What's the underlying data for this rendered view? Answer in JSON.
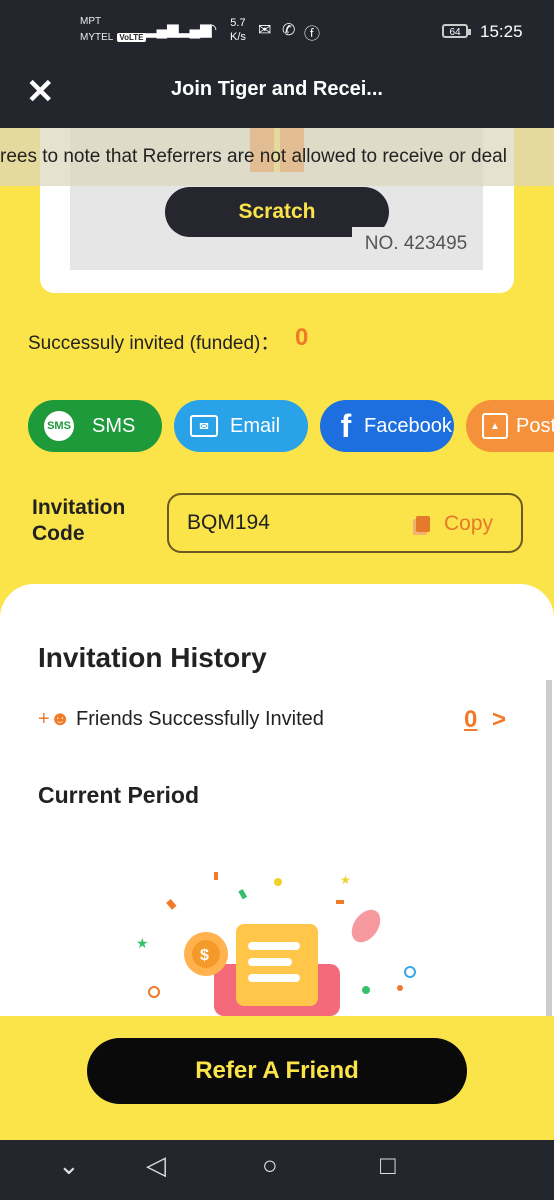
{
  "status_bar": {
    "carrier1": "MPT",
    "carrier2": "MYTEL",
    "volte": "VoLTE",
    "net_speed": "5.7",
    "net_unit": "K/s",
    "battery": "64",
    "time": "15:25"
  },
  "header": {
    "title": "Join Tiger and Recei..."
  },
  "scratch_card": {
    "button_label": "Scratch",
    "ticket_number": "NO. 423495"
  },
  "marquee_text": "rees to note that Referrers are not allowed to receive or deal",
  "invited": {
    "label": "Successuly invited (funded)：",
    "count": "0"
  },
  "share_buttons": [
    {
      "label": "SMS",
      "icon": "sms-icon",
      "color": "#1e9a3b"
    },
    {
      "label": "Email",
      "icon": "mail-icon",
      "color": "#2aa2e8"
    },
    {
      "label": "Facebook",
      "icon": "facebook-icon",
      "color": "#1d6fe0"
    },
    {
      "label": "Post",
      "icon": "image-icon",
      "color": "#f5913b"
    }
  ],
  "invitation": {
    "label_line1": "Invitation",
    "label_line2": "Code",
    "code": "BQM194",
    "copy_label": "Copy"
  },
  "history": {
    "title": "Invitation History",
    "friends_label": "Friends Successfully Invited",
    "friends_count": "0",
    "period_label": "Current Period"
  },
  "cta": {
    "label": "Refer A Friend"
  },
  "colors": {
    "brand_yellow": "#fbe34a",
    "accent_orange": "#f07a28",
    "dark": "#24262e"
  }
}
